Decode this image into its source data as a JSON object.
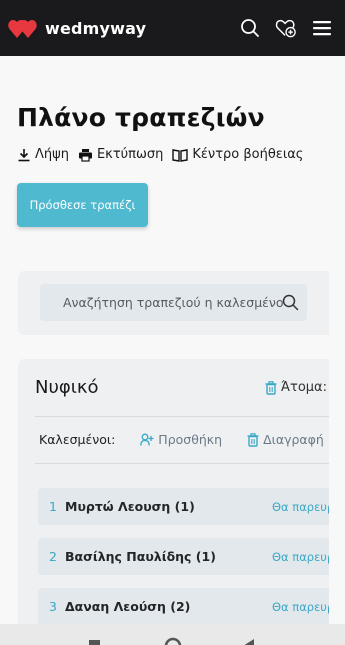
{
  "header": {
    "logo_text": "wedmyway",
    "icons": [
      "heart-logo-icon",
      "search-icon",
      "heart-plus-icon",
      "menu-icon"
    ]
  },
  "page": {
    "title": "Πλάνο τραπεζιών",
    "actions": {
      "download": "Λήψη",
      "print": "Εκτύπωση",
      "help": "Κέντρο βοήθειας"
    },
    "add_table_button": "Πρόσθεσε τραπέζι",
    "search_placeholder": "Αναζήτηση τραπεζιού η καλεσμένου"
  },
  "table": {
    "name": "Νυφικό",
    "people_label": "Άτομα:",
    "guests_label": "Καλεσμένοι:",
    "add_label": "Προσθήκη",
    "delete_label": "Διαγραφή",
    "guests": [
      {
        "num": "1",
        "name": "Μυρτώ Λεουση (1)",
        "status": "Θα παρευρεθεί"
      },
      {
        "num": "2",
        "name": "Βασίλης Παυλίδης (1)",
        "status": "Θα παρευρεθεί"
      },
      {
        "num": "3",
        "name": "Δαναη Λεούση (2)",
        "status": "Θα παρευρεθεί"
      }
    ]
  },
  "colors": {
    "accent": "#4fb9cf",
    "header_bg": "#1a1a1c",
    "brand_red": "#e8383f"
  }
}
